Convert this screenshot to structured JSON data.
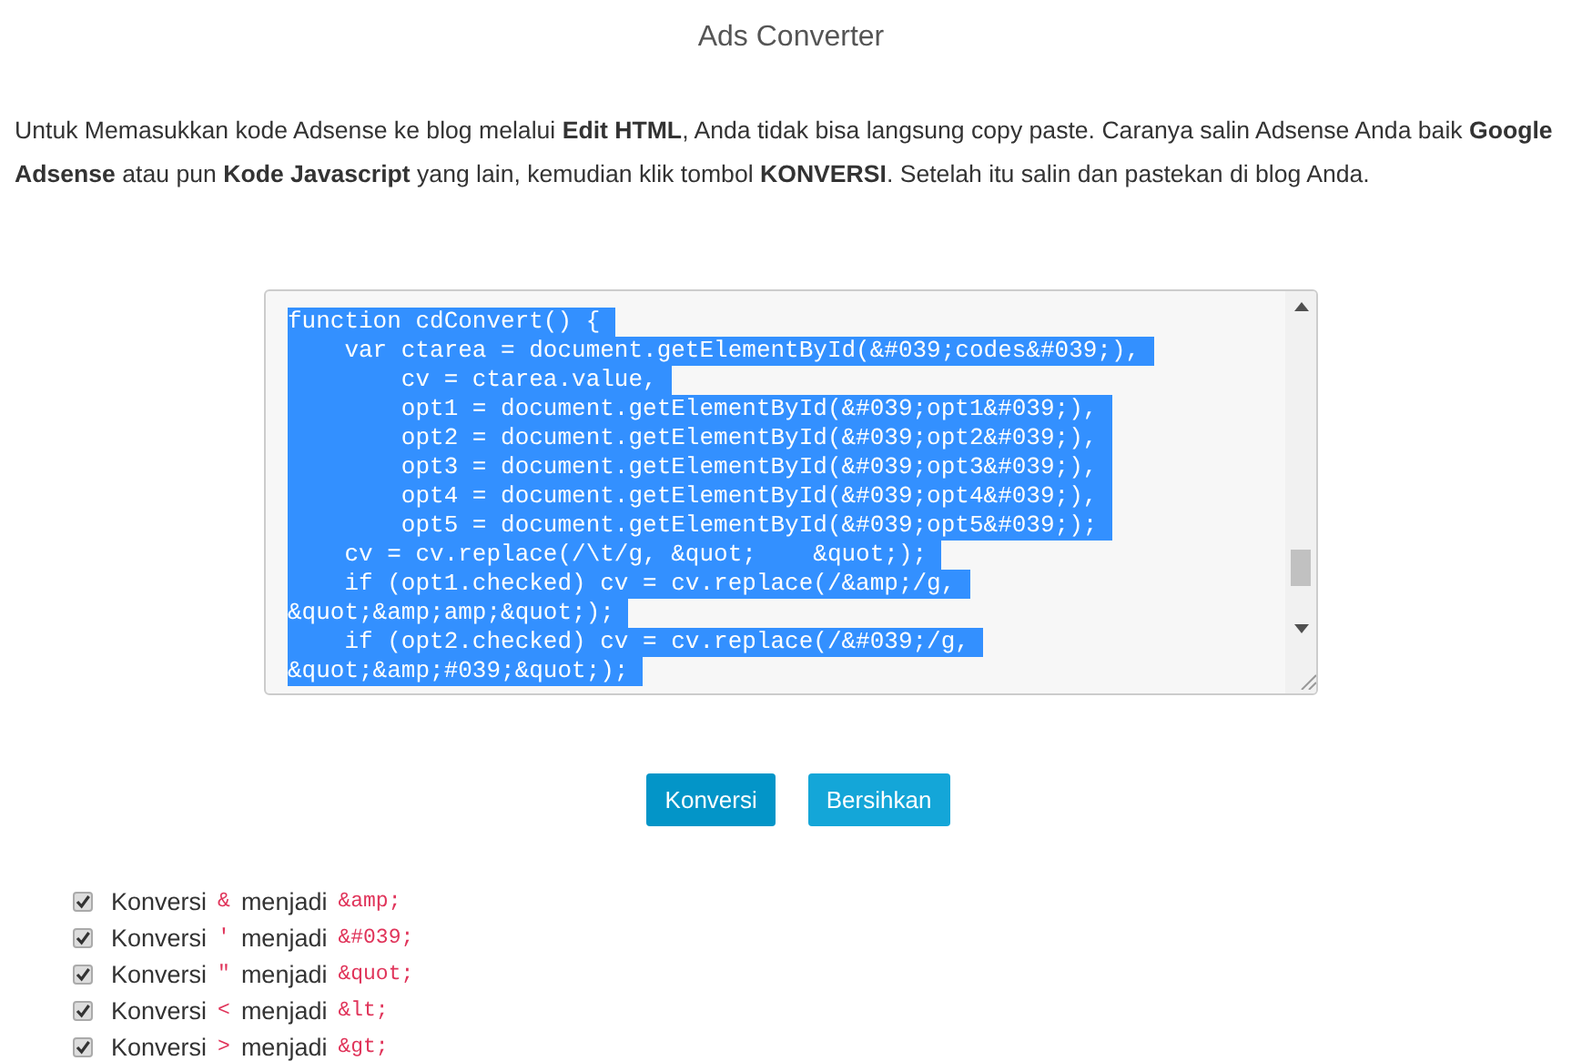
{
  "title": "Ads Converter",
  "intro": "Untuk Memasukkan kode Adsense ke blog melalui **Edit HTML**, Anda tidak bisa langsung copy paste. Caranya salin Adsense Anda baik **Google Adsense** atau pun **Kode Javascript** yang lain, kemudian klik tombol **KONVERSI**. Setelah itu salin dan pastekan di blog Anda.",
  "code_lines": [
    "function cdConvert() {",
    "    var ctarea = document.getElementById(&#039;codes&#039;),",
    "        cv = ctarea.value,",
    "        opt1 = document.getElementById(&#039;opt1&#039;),",
    "        opt2 = document.getElementById(&#039;opt2&#039;),",
    "        opt3 = document.getElementById(&#039;opt3&#039;),",
    "        opt4 = document.getElementById(&#039;opt4&#039;),",
    "        opt5 = document.getElementById(&#039;opt5&#039;);",
    "    cv = cv.replace(/\\t/g, &quot;    &quot;);",
    "    if (opt1.checked) cv = cv.replace(/&amp;/g,",
    "&quot;&amp;amp;&quot;);",
    "    if (opt2.checked) cv = cv.replace(/&#039;/g,",
    "&quot;&amp;#039;&quot;);"
  ],
  "buttons": [
    {
      "label": "Konversi",
      "kind": "primary"
    },
    {
      "label": "Bersihkan",
      "kind": "secondary"
    }
  ],
  "options": [
    {
      "checked": true,
      "label": "Konversi",
      "char": "&",
      "connector": "menjadi",
      "entity": "&amp;"
    },
    {
      "checked": true,
      "label": "Konversi",
      "char": "'",
      "connector": "menjadi",
      "entity": "&#039;"
    },
    {
      "checked": true,
      "label": "Konversi",
      "char": "\"",
      "connector": "menjadi",
      "entity": "&quot;"
    },
    {
      "checked": true,
      "label": "Konversi",
      "char": "<",
      "connector": "menjadi",
      "entity": "&lt;"
    },
    {
      "checked": true,
      "label": "Konversi",
      "char": ">",
      "connector": "menjadi",
      "entity": "&gt;"
    }
  ]
}
